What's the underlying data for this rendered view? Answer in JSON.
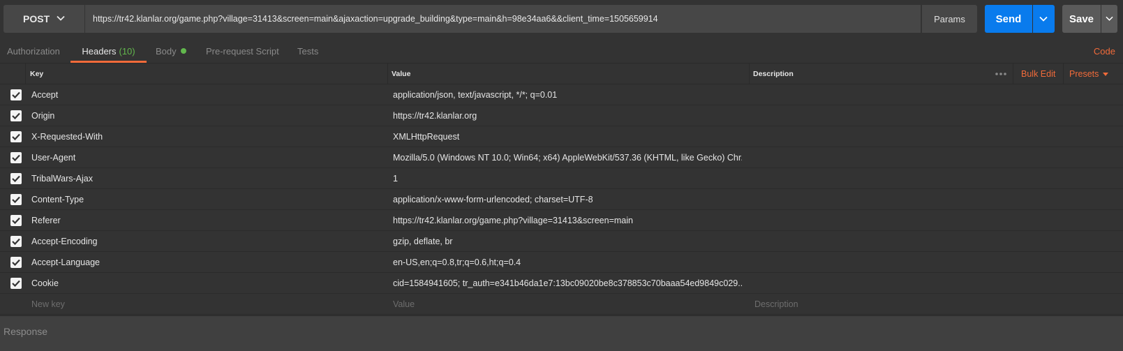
{
  "request": {
    "method": "POST",
    "url": "https://tr42.klanlar.org/game.php?village=31413&screen=main&ajaxaction=upgrade_building&type=main&h=98e34aa6&&client_time=1505659914",
    "params_label": "Params",
    "send_label": "Send",
    "save_label": "Save"
  },
  "tabs": [
    {
      "label": "Authorization"
    },
    {
      "label": "Headers",
      "count": "(10)"
    },
    {
      "label": "Body"
    },
    {
      "label": "Pre-request Script"
    },
    {
      "label": "Tests"
    }
  ],
  "code_label": "Code",
  "headers_table": {
    "columns": {
      "key": "Key",
      "value": "Value",
      "description": "Description"
    },
    "bulk_edit_label": "Bulk Edit",
    "presets_label": "Presets",
    "rows": [
      {
        "key": "Accept",
        "value": "application/json, text/javascript, */*; q=0.01",
        "description": ""
      },
      {
        "key": "Origin",
        "value": "https://tr42.klanlar.org",
        "description": ""
      },
      {
        "key": "X-Requested-With",
        "value": "XMLHttpRequest",
        "description": ""
      },
      {
        "key": "User-Agent",
        "value": "Mozilla/5.0 (Windows NT 10.0; Win64; x64) AppleWebKit/537.36 (KHTML, like Gecko) Chr...",
        "description": ""
      },
      {
        "key": "TribalWars-Ajax",
        "value": "1",
        "description": ""
      },
      {
        "key": "Content-Type",
        "value": "application/x-www-form-urlencoded; charset=UTF-8",
        "description": ""
      },
      {
        "key": "Referer",
        "value": "https://tr42.klanlar.org/game.php?village=31413&screen=main",
        "description": ""
      },
      {
        "key": "Accept-Encoding",
        "value": "gzip, deflate, br",
        "description": ""
      },
      {
        "key": "Accept-Language",
        "value": "en-US,en;q=0.8,tr;q=0.6,ht;q=0.4",
        "description": ""
      },
      {
        "key": "Cookie",
        "value": "cid=1584941605; tr_auth=e341b46da1e7:13bc09020be8c378853c70baaa54ed9849c029...",
        "description": ""
      }
    ],
    "new_row": {
      "key_placeholder": "New key",
      "value_placeholder": "Value",
      "description_placeholder": "Description"
    }
  },
  "response_label": "Response",
  "colors": {
    "accent": "#f26b3a",
    "send": "#097bed",
    "success": "#62b84d",
    "background": "#333333"
  }
}
